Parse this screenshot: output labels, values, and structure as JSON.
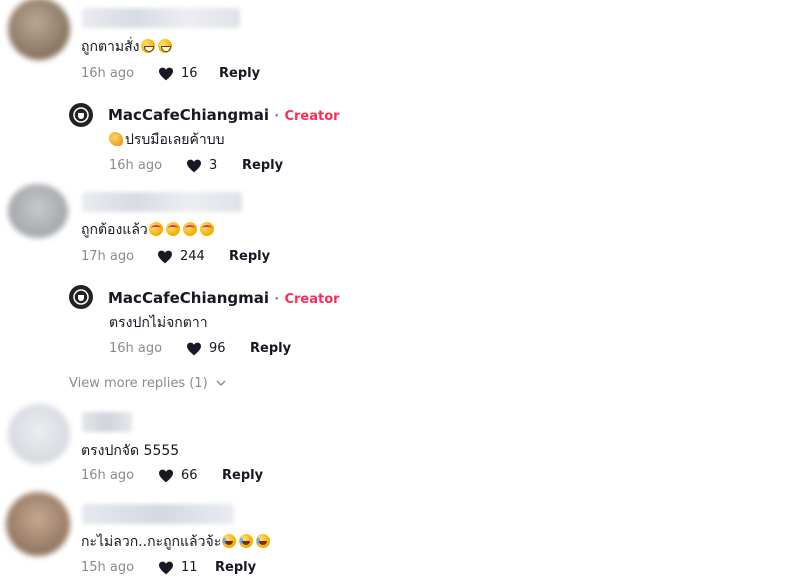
{
  "comments": [
    {
      "text": "ถูกตามสั่ง",
      "time": "16h ago",
      "likes": "16",
      "reply_label": "Reply",
      "emojis": [
        "grin-icon",
        "grin-icon"
      ],
      "reply": {
        "author": "MacCafeChiangmai",
        "separator": "·",
        "tag": "Creator",
        "text": "ปรบมือเลยค้าบบ",
        "time": "16h ago",
        "likes": "3",
        "reply_label": "Reply",
        "emojis": [
          "clapping-hands-icon"
        ]
      }
    },
    {
      "text": "ถูกต้องแล้ว",
      "time": "17h ago",
      "likes": "244",
      "reply_label": "Reply",
      "emojis": [
        "smiling-hearts-icon",
        "smiling-hearts-icon",
        "smiling-hearts-icon",
        "smiling-hearts-icon"
      ],
      "reply": {
        "author": "MacCafeChiangmai",
        "separator": "·",
        "tag": "Creator",
        "text": "ตรงปกไม่จกตาา",
        "time": "16h ago",
        "likes": "96",
        "reply_label": "Reply"
      },
      "view_more": "View more replies (1)"
    },
    {
      "text": "ตรงปกจัด 5555",
      "time": "16h ago",
      "likes": "66",
      "reply_label": "Reply"
    },
    {
      "text": "กะไม่ลวก..กะถูกแล้วจ้ะ",
      "time": "15h ago",
      "likes": "11",
      "reply_label": "Reply",
      "emojis": [
        "laughing-tears-icon",
        "laughing-tears-icon",
        "laughing-tears-icon"
      ]
    }
  ],
  "colors": {
    "creator_tag": "#fe2c55",
    "meta_text": "#8a8b91",
    "primary_text": "#161823"
  }
}
